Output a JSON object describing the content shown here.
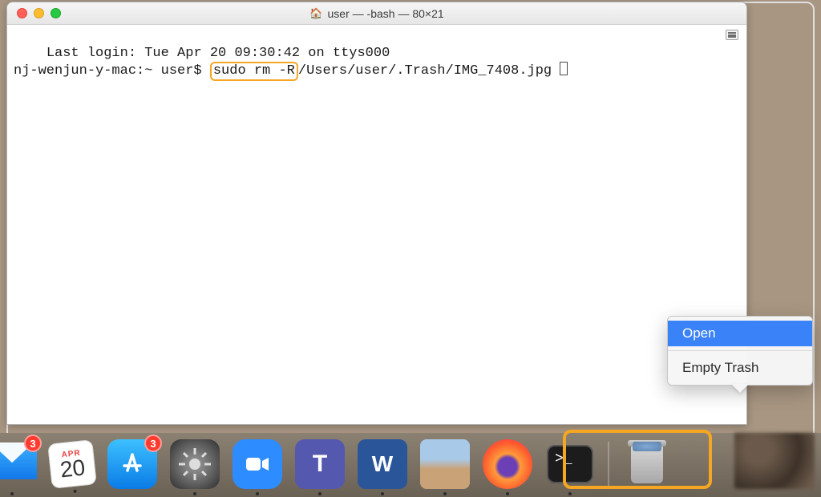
{
  "window": {
    "title": "user — -bash — 80×21"
  },
  "terminal": {
    "line1": "Last login: Tue Apr 20 09:30:42 on ttys000",
    "prompt": "nj-wenjun-y-mac:~ user$ ",
    "cmd_highlight": "sudo rm -R",
    "cmd_rest": "/Users/user/.Trash/IMG_7408.jpg "
  },
  "context_menu": {
    "open": "Open",
    "empty": "Empty Trash"
  },
  "dock": {
    "mail_badge": "3",
    "cal_month": "APR",
    "cal_day": "20",
    "appstore_badge": "3",
    "terminal_prompt": ">_"
  }
}
